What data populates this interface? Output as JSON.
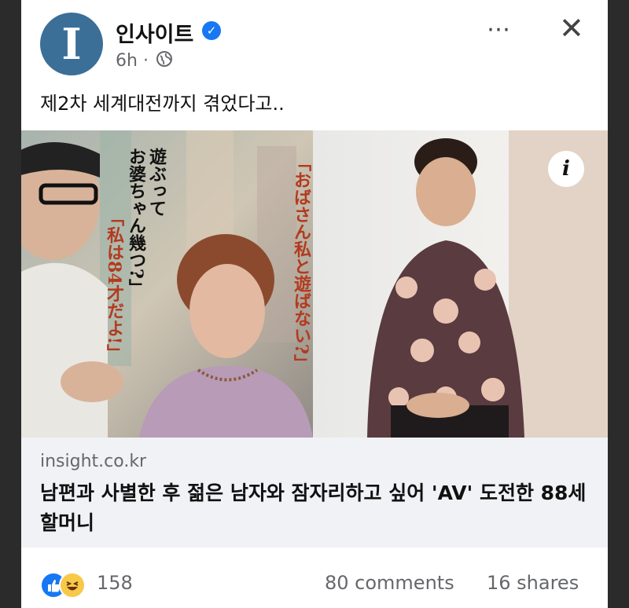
{
  "post": {
    "author": "인사이트",
    "avatar_letter": "I",
    "time": "6h",
    "separator": "·",
    "caption": "제2차 세계대전까지 겪었다고..",
    "more_icon": "⋯",
    "close_icon": "✕",
    "verified_icon": "✓"
  },
  "photo": {
    "info_icon": "i",
    "left_texts": [
      "遊ぶって",
      "お婆ちゃん幾つ?」",
      "「私は84才だよ!」"
    ],
    "middle_text": "「おばさん私と遊ばない?」"
  },
  "link": {
    "domain": "insight.co.kr",
    "headline": "남편과 사별한 후 젊은 남자와 잠자리하고 싶어 'AV' 도전한 88세 할머니"
  },
  "footer": {
    "reaction_count": "158",
    "comments": "80 comments",
    "shares": "16 shares"
  }
}
